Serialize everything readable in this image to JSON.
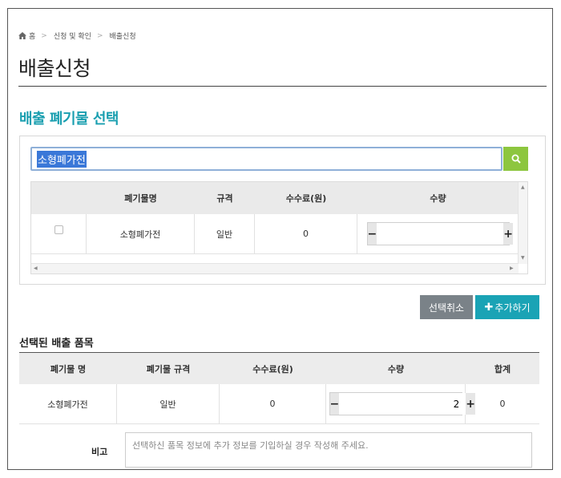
{
  "breadcrumb": {
    "home": "홈",
    "items": [
      "신청 및 확인",
      "배출신청"
    ]
  },
  "page_title": "배출신청",
  "picker": {
    "title": "배출 폐기물 선택",
    "search_value": "소형폐가전",
    "search_icon": "search-icon",
    "columns": [
      "폐기물명",
      "규격",
      "수수료(원)",
      "수량"
    ],
    "rows": [
      {
        "checked": false,
        "name": "소형폐가전",
        "spec": "일반",
        "fee": "0",
        "qty": ""
      }
    ],
    "minus": "−",
    "plus": "+"
  },
  "actions": {
    "deselect_label": "선택취소",
    "add_label": "추가하기"
  },
  "selected": {
    "title": "선택된 배출 품목",
    "columns": [
      "폐기물 명",
      "폐기물 규격",
      "수수료(원)",
      "수량",
      "합계"
    ],
    "rows": [
      {
        "name": "소형폐가전",
        "spec": "일반",
        "fee": "0",
        "qty": "2",
        "total": "0"
      }
    ],
    "minus": "−",
    "plus": "+"
  },
  "remarks": {
    "label": "비고",
    "placeholder": "선택하신 품목 정보에 추가 정보를 기입하실 경우 작성해 주세요."
  },
  "colors": {
    "accent": "#1aa3b5",
    "search_button": "#8dc63f",
    "deselect_button": "#7a8288",
    "selection": "#3a78d8"
  }
}
